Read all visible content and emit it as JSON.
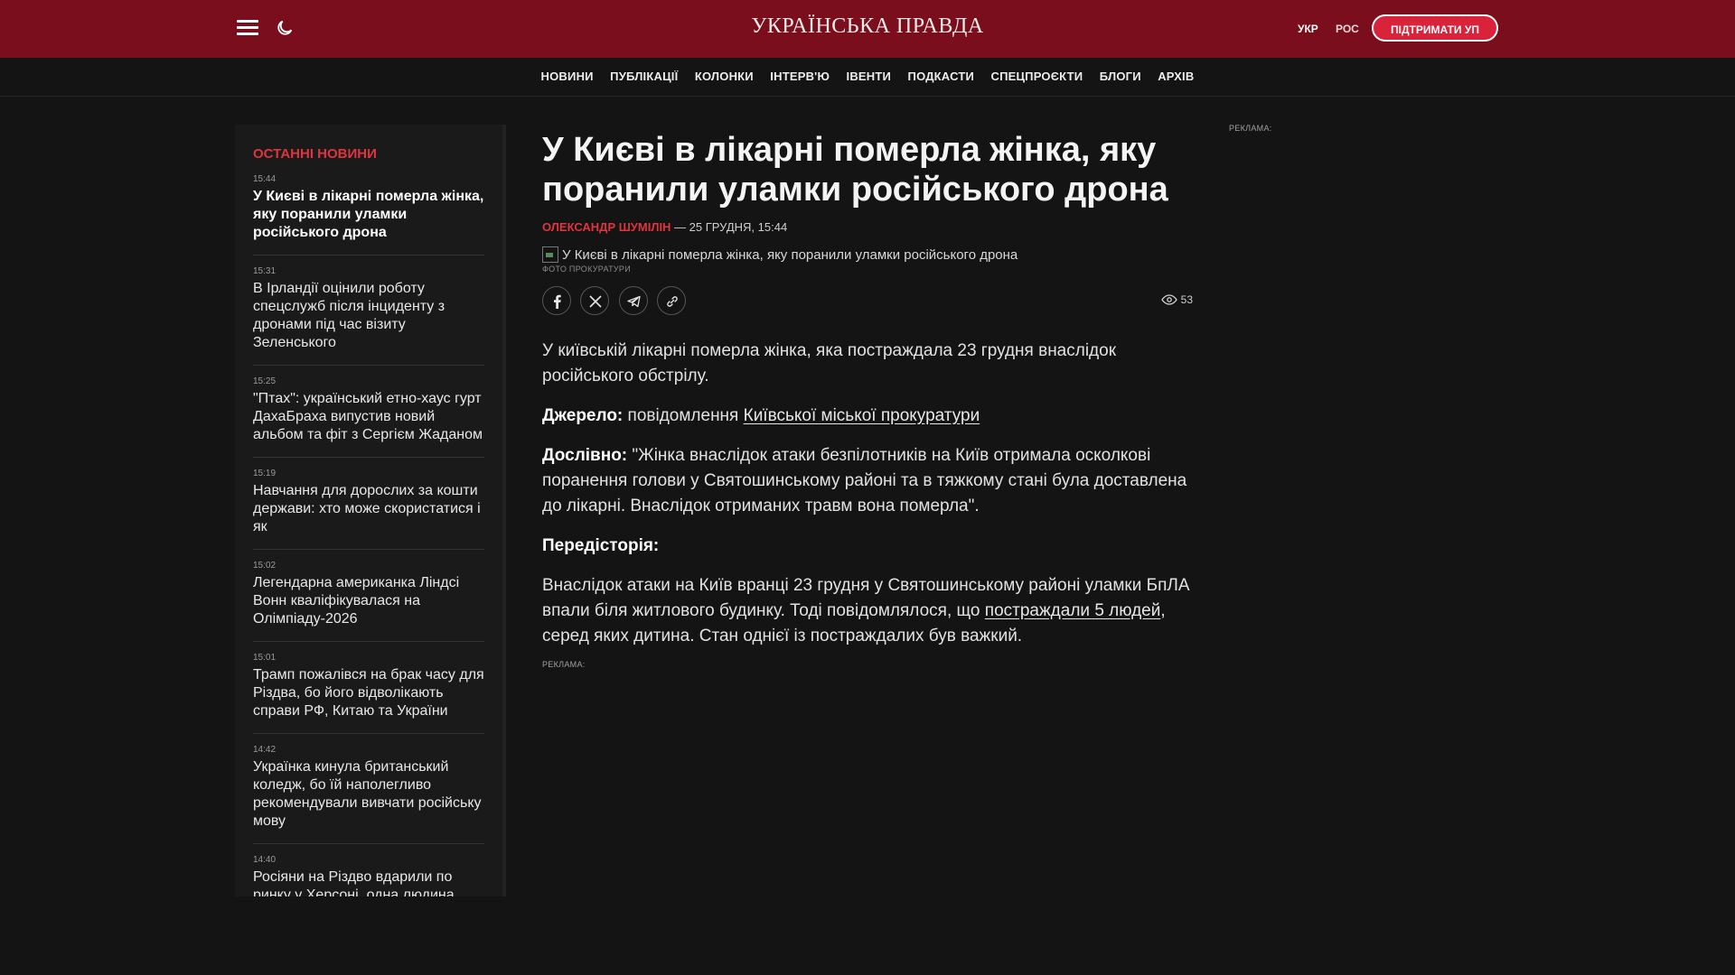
{
  "header": {
    "logo": "УКРАЇНСЬКА ПРАВДА",
    "lang_ukr": "УКР",
    "lang_ros": "РОС",
    "support_label": "ПІДТРИМАТИ УП"
  },
  "nav": {
    "items": [
      "НОВИНИ",
      "ПУБЛІКАЦІЇ",
      "КОЛОНКИ",
      "ІНТЕРВ'Ю",
      "ІВЕНТИ",
      "ПОДКАСТИ",
      "СПЕЦПРОЄКТИ",
      "БЛОГИ",
      "АРХІВ"
    ]
  },
  "sidebar": {
    "title": "ОСТАННІ НОВИНИ",
    "items": [
      {
        "time": "15:44",
        "headline": "У Києві в лікарні померла жінка, яку поранили уламки російського дрона"
      },
      {
        "time": "15:31",
        "headline": "В Ірландії оцінили роботу спецслужб після інциденту з дронами під час візиту Зеленського"
      },
      {
        "time": "15:25",
        "headline": "\"Птах\": український етно-хаус гурт ДахаБраха випустив новий альбом та фіт з Сергієм Жаданом"
      },
      {
        "time": "15:19",
        "headline": "Навчання для дорослих за кошти держави: хто може скористатися і як"
      },
      {
        "time": "15:02",
        "headline": "Легендарна американка Ліндсі Вонн кваліфікувалася на Олімпіаду-2026"
      },
      {
        "time": "15:01",
        "headline": "Трамп пожалівся на брак часу для Різдва, бо його відволікають справи РФ, Китаю та України"
      },
      {
        "time": "14:42",
        "headline": "Українка кинула британський коледж, бо їй наполегливо рекомендували вивчати російську мову"
      },
      {
        "time": "14:40",
        "headline": "Росіяни на Різдво вдарили по ринку у Херсоні, одна людина"
      }
    ]
  },
  "article": {
    "title": "У Києві в лікарні померла жінка, яку поранили уламки російського дрона",
    "author": "ОЛЕКСАНДР ШУМІЛІН",
    "date": " — 25 ГРУДНЯ, 15:44",
    "image_alt": "У Києві в лікарні померла жінка, яку поранили уламки російського дрона",
    "caption": "ФОТО ПРОКУРАТУРИ",
    "views": "53",
    "p1": "У київській лікарні померла жінка, яка постраждала 23 грудня внаслідок російського обстрілу.",
    "source_label": "Джерело:",
    "source_text": " повідомлення ",
    "source_link": "Київської міської прокуратури",
    "quote_label": "Дослівно:",
    "quote_text": " \"Жінка внаслідок атаки безпілотників на Київ отримала осколкові поранення голови у Святошинському районі та в тяжкому стані була доставлена до лікарні. Внаслідок отриманих травм вона померла\".",
    "background_label": "Передісторія:",
    "p_background_start": "Внаслідок атаки на Київ вранці 23 грудня у Святошинському районі уламки БпЛА впали біля житлового будинку. Тоді повідомлялося, що ",
    "p_background_link": "постраждали 5 людей",
    "p_background_end": ", серед яких дитина. Стан однієї із постраждалих був важкий.",
    "ad_label": "РЕКЛАМА:"
  },
  "right_ad_label": "РЕКЛАМА:",
  "colors": {
    "header_bg": "#7a0e1c",
    "accent": "#e0343f",
    "page_bg": "#141414"
  }
}
